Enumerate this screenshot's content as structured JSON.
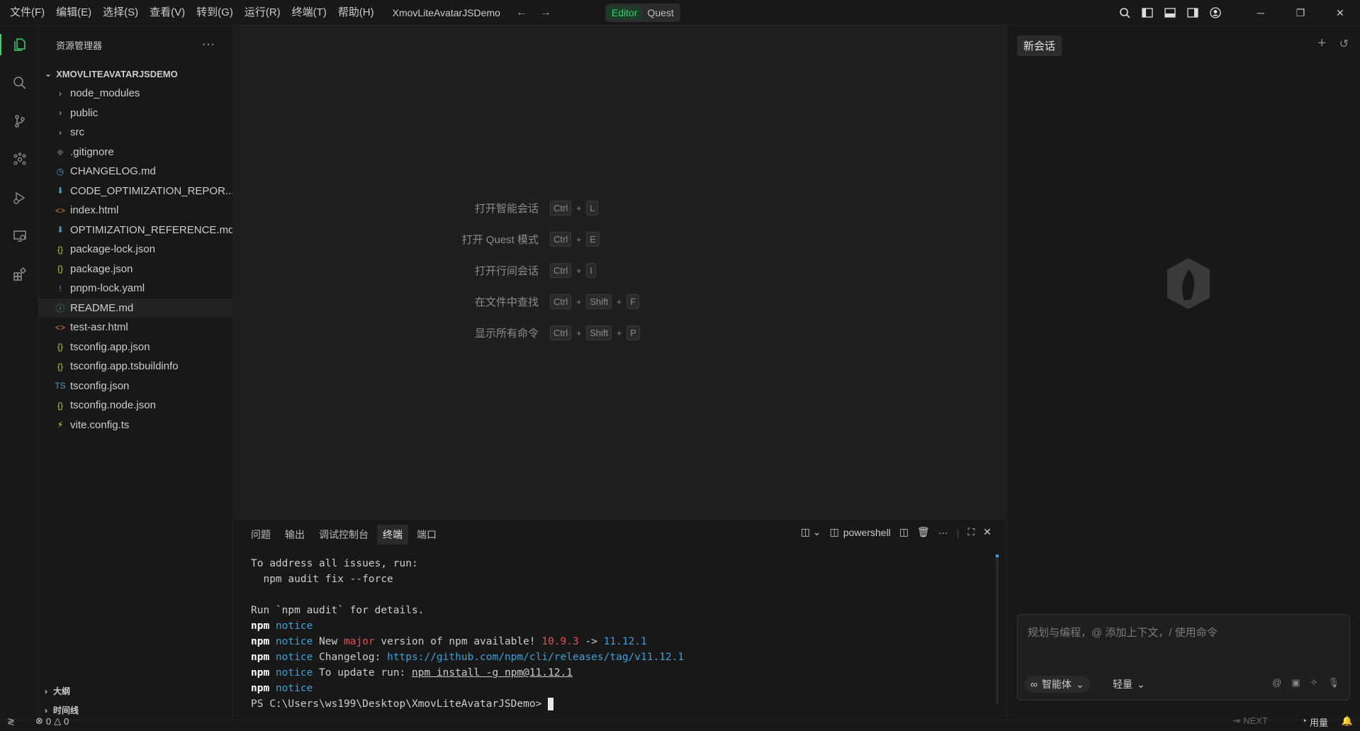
{
  "titlebar": {
    "menus": [
      "文件(F)",
      "编辑(E)",
      "选择(S)",
      "查看(V)",
      "转到(G)",
      "运行(R)",
      "终端(T)",
      "帮助(H)"
    ],
    "title": "XmovLiteAvatarJSDemo",
    "mode_editor": "Editor",
    "mode_quest": "Quest"
  },
  "sidebar": {
    "header": "资源管理器",
    "more": "···",
    "root": "XMOVLITEAVATARJSDEMO",
    "items": [
      {
        "label": "node_modules",
        "type": "folder",
        "icon": "chevron-right",
        "color": "#bbbbbb"
      },
      {
        "label": "public",
        "type": "folder",
        "icon": "chevron-right",
        "color": "#bbbbbb"
      },
      {
        "label": "src",
        "type": "folder",
        "icon": "chevron-right",
        "color": "#bbbbbb"
      },
      {
        "label": ".gitignore",
        "type": "file",
        "icon": "◆",
        "color": "#41535b"
      },
      {
        "label": "CHANGELOG.md",
        "type": "file",
        "icon": "◷",
        "color": "#519aba"
      },
      {
        "label": "CODE_OPTIMIZATION_REPOR...",
        "type": "file",
        "icon": "⬇",
        "color": "#519aba"
      },
      {
        "label": "index.html",
        "type": "file",
        "icon": "<>",
        "color": "#e37933"
      },
      {
        "label": "OPTIMIZATION_REFERENCE.md",
        "type": "file",
        "icon": "⬇",
        "color": "#519aba"
      },
      {
        "label": "package-lock.json",
        "type": "file",
        "icon": "{}",
        "color": "#cbcb41"
      },
      {
        "label": "package.json",
        "type": "file",
        "icon": "{}",
        "color": "#cbcb41"
      },
      {
        "label": "pnpm-lock.yaml",
        "type": "file",
        "icon": "!",
        "color": "#a074c4"
      },
      {
        "label": "README.md",
        "type": "file",
        "icon": "ⓘ",
        "color": "#519aba",
        "selected": true
      },
      {
        "label": "test-asr.html",
        "type": "file",
        "icon": "<>",
        "color": "#e37933"
      },
      {
        "label": "tsconfig.app.json",
        "type": "file",
        "icon": "{}",
        "color": "#cbcb41"
      },
      {
        "label": "tsconfig.app.tsbuildinfo",
        "type": "file",
        "icon": "{}",
        "color": "#cbcb41"
      },
      {
        "label": "tsconfig.json",
        "type": "file",
        "icon": "TS",
        "color": "#519aba"
      },
      {
        "label": "tsconfig.node.json",
        "type": "file",
        "icon": "{}",
        "color": "#cbcb41"
      },
      {
        "label": "vite.config.ts",
        "type": "file",
        "icon": "⚡",
        "color": "#e8c547"
      }
    ],
    "outline": "大纲",
    "timeline": "时间线"
  },
  "editor_hints": [
    {
      "label": "打开智能会话",
      "keys": [
        "Ctrl",
        "L"
      ]
    },
    {
      "label": "打开 Quest 模式",
      "keys": [
        "Ctrl",
        "E"
      ]
    },
    {
      "label": "打开行间会话",
      "keys": [
        "Ctrl",
        "I"
      ]
    },
    {
      "label": "在文件中查找",
      "keys": [
        "Ctrl",
        "Shift",
        "F"
      ]
    },
    {
      "label": "显示所有命令",
      "keys": [
        "Ctrl",
        "Shift",
        "P"
      ]
    }
  ],
  "panel": {
    "tabs": [
      "问题",
      "输出",
      "调试控制台",
      "终端",
      "端口"
    ],
    "active_tab": "终端",
    "shell": "powershell",
    "terminal": {
      "line1": "To address all issues, run:",
      "line2": "  npm audit fix --force",
      "line4": "Run `npm audit` for details.",
      "npm": "npm",
      "notice": "notice",
      "l6a": " New ",
      "l6major": "major",
      "l6b": " version of npm available! ",
      "l6old": "10.9.3",
      "l6arrow": " -> ",
      "l6new": "11.12.1",
      "l7a": " Changelog: ",
      "l7url": "https://github.com/npm/cli/releases/tag/v11.12.1",
      "l8a": " To update run: ",
      "l8cmd": "npm install -g npm@11.12.1",
      "prompt": "PS C:\\Users\\ws199\\Desktop\\XmovLiteAvatarJSDemo> "
    }
  },
  "chat": {
    "tab": "新会话",
    "placeholder": "规划与编程，@ 添加上下文，/ 使用命令",
    "agent": "智能体",
    "mode": "轻量"
  },
  "statusbar": {
    "errors": "0",
    "warnings": "0",
    "next": "NEXT",
    "usage": "用量"
  }
}
